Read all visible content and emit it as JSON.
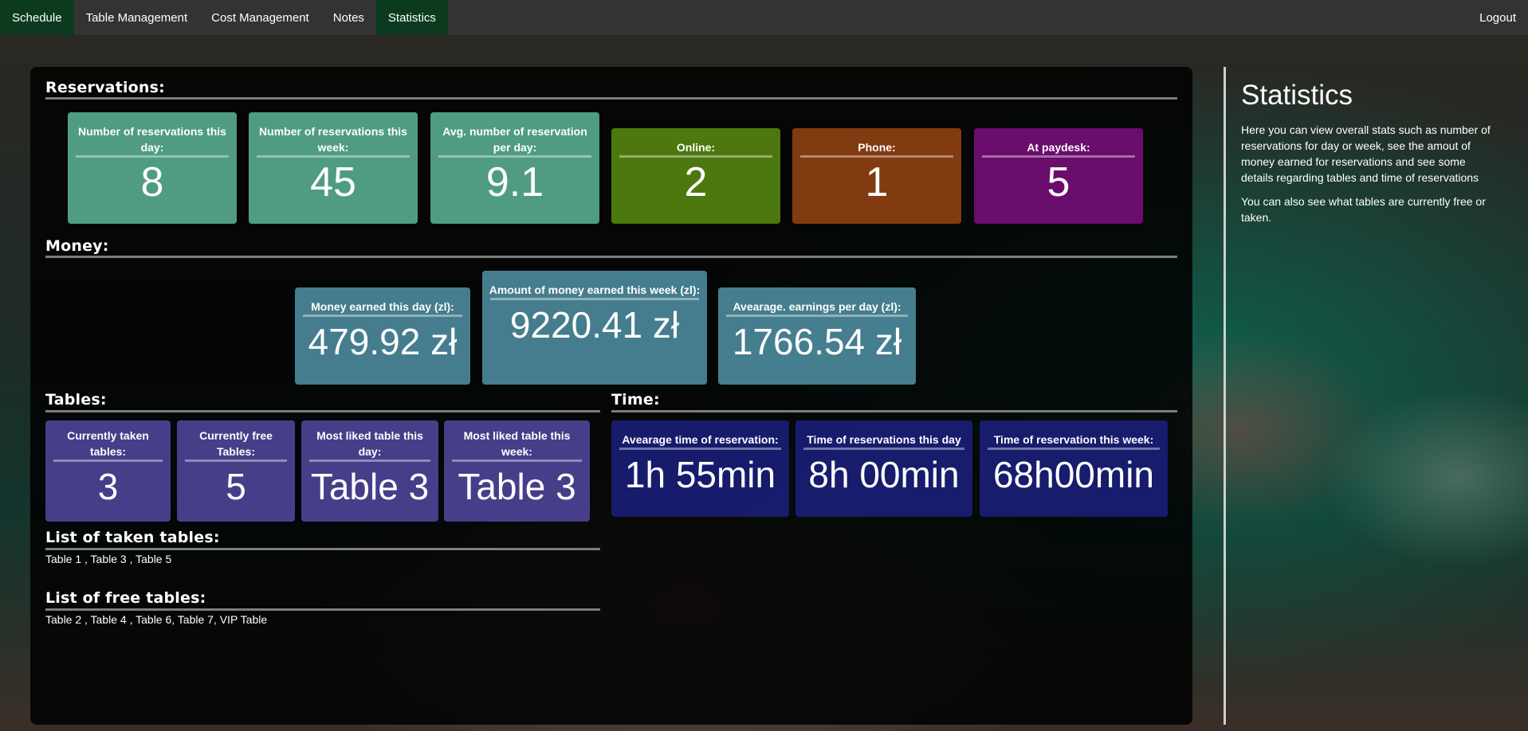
{
  "nav": {
    "items": [
      "Schedule",
      "Table Management",
      "Cost Management",
      "Notes",
      "Statistics"
    ],
    "logout": "Logout"
  },
  "reservations": {
    "title": "Reservations:",
    "cards": [
      {
        "label": "Number of reservations this day:",
        "value": "8"
      },
      {
        "label": "Number of reservations this week:",
        "value": "45"
      },
      {
        "label": "Avg. number of reservation per day:",
        "value": "9.1"
      },
      {
        "label": "Online:",
        "value": "2"
      },
      {
        "label": "Phone:",
        "value": "1"
      },
      {
        "label": "At paydesk:",
        "value": "5"
      }
    ]
  },
  "money": {
    "title": "Money:",
    "cards": [
      {
        "label": "Money earned this day (zl):",
        "value": "479.92 zł"
      },
      {
        "label": "Amount of money earned this week (zl):",
        "value": "9220.41 zł"
      },
      {
        "label": "Avearage. earnings per day (zl):",
        "value": "1766.54 zł"
      }
    ]
  },
  "tables": {
    "title": "Tables:",
    "cards": [
      {
        "label": "Currently taken tables:",
        "value": "3"
      },
      {
        "label": "Currently free Tables:",
        "value": "5"
      },
      {
        "label": "Most liked table this day:",
        "value": "Table 3"
      },
      {
        "label": "Most liked table this week:",
        "value": "Table 3"
      }
    ],
    "taken_title": "List of taken tables:",
    "taken_list": "Table 1 , Table 3 , Table 5",
    "free_title": "List of free tables:",
    "free_list": "Table 2 , Table 4 , Table 6, Table 7, VIP Table"
  },
  "time": {
    "title": "Time:",
    "cards": [
      {
        "label": "Avearage time of reservation:",
        "value": "1h 55min"
      },
      {
        "label": "Time of reservations this day",
        "value": "8h 00min"
      },
      {
        "label": "Time of reservation this week:",
        "value": "68h00min"
      }
    ]
  },
  "sidebar": {
    "title": "Statistics",
    "p1": "Here you can view overall stats such as number of reservations for day or week, see the amout of money earned for reservations and see some details regarding tables and time of reservations",
    "p2": "You can also see what tables are currently free or taken."
  },
  "colors": {
    "nav_bg": "#333333",
    "nav_active": "#0c3a1e",
    "teal": "#5ab294",
    "olive": "#4c780f",
    "orange": "#823a10",
    "purple": "#6a0d6c",
    "steel_blue": "#4e8ea2",
    "indigo": "#5248a0",
    "navy": "#1a1e78"
  }
}
